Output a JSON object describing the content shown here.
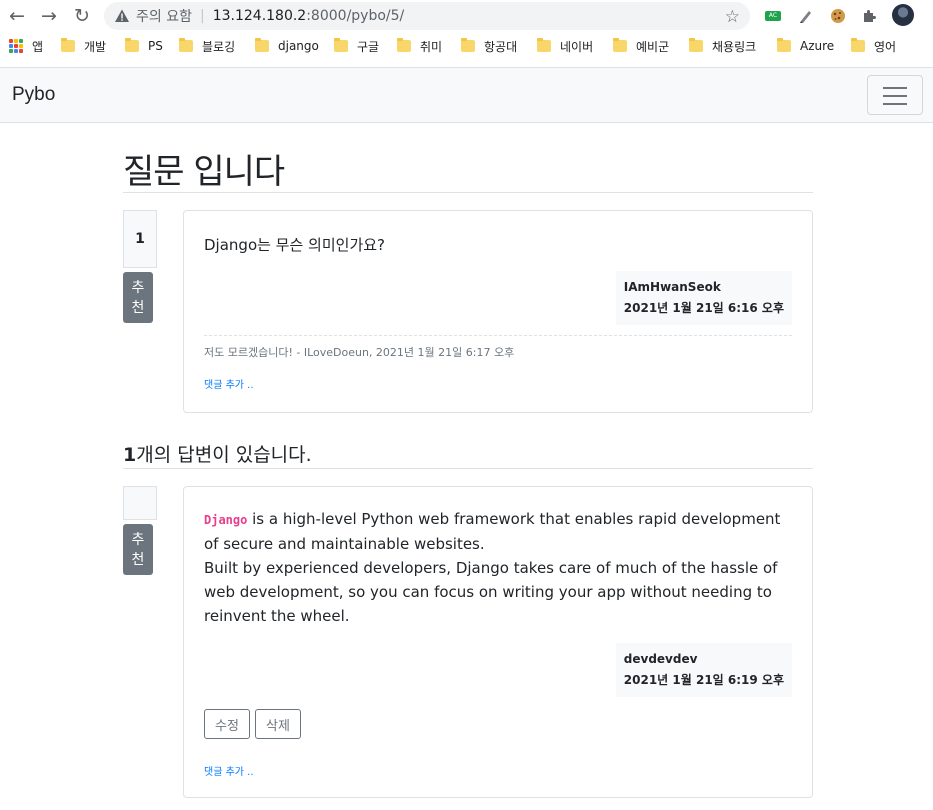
{
  "browser": {
    "security_label": "주의 요함",
    "url_host": "13.124.180.2",
    "url_path": ":8000/pybo/5/",
    "bookmarks": [
      {
        "label": "앱"
      },
      {
        "label": "개발"
      },
      {
        "label": "PS"
      },
      {
        "label": "블로깅"
      },
      {
        "label": "django"
      },
      {
        "label": "구글"
      },
      {
        "label": "취미"
      },
      {
        "label": "항공대"
      },
      {
        "label": "네이버"
      },
      {
        "label": "예비군"
      },
      {
        "label": "채용링크"
      },
      {
        "label": "Azure"
      },
      {
        "label": "영어"
      }
    ],
    "ext_ac_label": "AC",
    "back_icon": "←",
    "forward_icon": "→",
    "reload_icon": "↻",
    "star_icon": "☆"
  },
  "navbar": {
    "brand": "Pybo"
  },
  "question": {
    "title": "질문 입니다",
    "vote_count": "1",
    "recommend_label_1": "추",
    "recommend_label_2": "천",
    "content": "Django는 무슨 의미인가요?",
    "author": "IAmHwanSeok",
    "date": "2021년 1월 21일 6:16 오후",
    "comment": "저도 모르겠습니다! - ILoveDoeun, 2021년 1월 21일 6:17 오후",
    "add_comment": "댓글 추가 .."
  },
  "answers_header": {
    "count": "1",
    "suffix": "개의 답변이 있습니다."
  },
  "answer": {
    "vote_count": "",
    "recommend_label_1": "추",
    "recommend_label_2": "천",
    "code": "Django",
    "line1_rest": " is a high-level Python web framework that enables rapid development of secure and maintainable websites.",
    "line2": "Built by experienced developers, Django takes care of much of the hassle of web development, so you can focus on writing your app without needing to reinvent the wheel.",
    "author": "devdevdev",
    "date": "2021년 1월 21일 6:19 오후",
    "edit_label": "수정",
    "delete_label": "삭제",
    "add_comment": "댓글 추가 .."
  }
}
